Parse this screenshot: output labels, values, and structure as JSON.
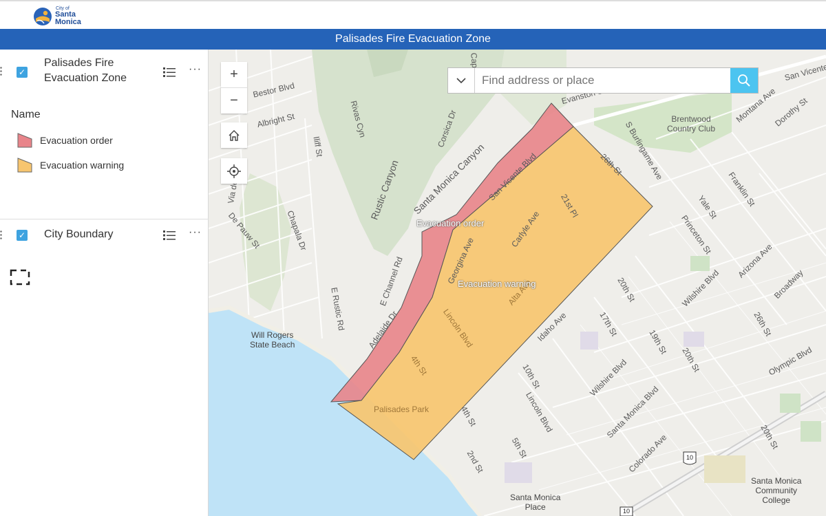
{
  "header": {
    "logo_small": "City of",
    "logo_line1": "Santa",
    "logo_line2": "Monica",
    "title": "Palisades Fire Evacuation Zone"
  },
  "sidebar": {
    "layers": [
      {
        "title_line1": "Palisades Fire",
        "title_line2": "Evacuation Zone",
        "checked": true
      },
      {
        "title_line1": "City Boundary",
        "checked": true
      }
    ],
    "legend_heading": "Name",
    "legend_items": [
      {
        "label": "Evacuation order",
        "color": "#e8848a"
      },
      {
        "label": "Evacuation warning",
        "color": "#f7c56f"
      }
    ],
    "more_label": "···"
  },
  "map": {
    "search_placeholder": "Find address or place",
    "zoom_in": "+",
    "zoom_out": "−",
    "zone_labels": [
      "Evacuation order",
      "Evacuation warning"
    ],
    "labels": [
      "Bestor Blvd",
      "Albright St",
      "Iliff St",
      "Rivas Cyn",
      "Corsica Dr",
      "Capri",
      "Santa Monica Canyon",
      "Rustic Canyon",
      "Evanston St",
      "Brentwood",
      "Country Club",
      "S Burlingame Ave",
      "Montana Ave",
      "Dorothy St",
      "San Vicente",
      "Via de",
      "De Pauw St",
      "Chapala Dr",
      "E Channel Rd",
      "E Rustic Rd",
      "Adelaide Dr",
      "San Vicente Blvd",
      "Georgina Ave",
      "Carlyle Ave",
      "21st Pl",
      "26th St",
      "Franklin St",
      "Yale St",
      "Princeton St",
      "Wilshire Blvd",
      "Arizona Ave",
      "Broadway",
      "26th St",
      "Olympic Blvd",
      "20th St",
      "19th St",
      "20th St",
      "17th St",
      "Idaho Ave",
      "10th St",
      "Lincoln Blvd",
      "Wilshire Blvd",
      "Santa Monica Blvd",
      "Colorado Ave",
      "20th St",
      "4th St",
      "5th St",
      "2nd St",
      "Alta Ave",
      "Lincoln Blvd",
      "4th St",
      "Palisades Park",
      "Will Rogers",
      "State Beach",
      "Santa Monica",
      "Place",
      "Santa Monica",
      "Community",
      "College",
      "10",
      "10"
    ],
    "colors": {
      "order_fill": "#e8848a",
      "warning_fill": "#f7c56f",
      "water": "#bfe3f7",
      "park": "#cfe3c6",
      "road": "#ffffff"
    }
  }
}
